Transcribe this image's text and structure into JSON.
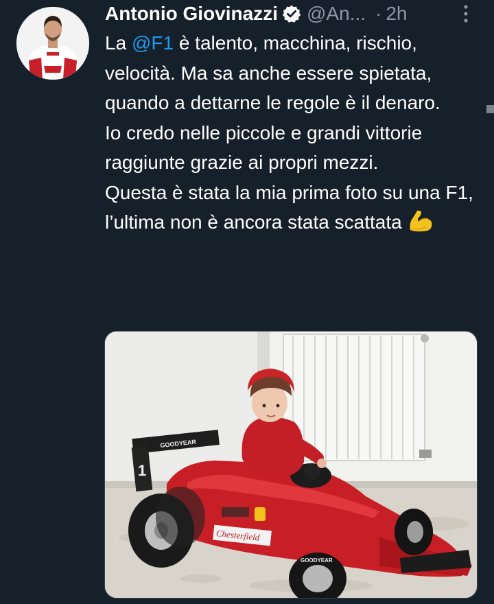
{
  "tweet": {
    "author_name": "Antonio Giovinazzi",
    "handle": "@An...",
    "separator": "·",
    "time": "2h",
    "body": {
      "line1_before": "La ",
      "mention": "@F1",
      "line1_after": " è talento, macchina, rischio, velocità. Ma sa anche essere spietata, quando a dettarne le regole è il denaro.",
      "paragraph2": "Io credo nelle piccole e grandi vittorie raggiunte grazie ai propri mezzi.",
      "paragraph3": "Questa è stata la mia prima foto su una F1, l’ultima non è ancora stata scattata",
      "emoji": "flexed-biceps"
    }
  },
  "photo": {
    "car_number": "1",
    "sponsor_rear": "GOODYEAR",
    "sponsor_side": "Chesterfield",
    "tire_brand": "GOODYEAR"
  },
  "colors": {
    "background": "#15202b",
    "text": "#ffffff",
    "secondary": "#8b98a5",
    "link": "#1d9bf0",
    "verified": "#1d9bf0",
    "ferrari_red": "#d42027"
  }
}
